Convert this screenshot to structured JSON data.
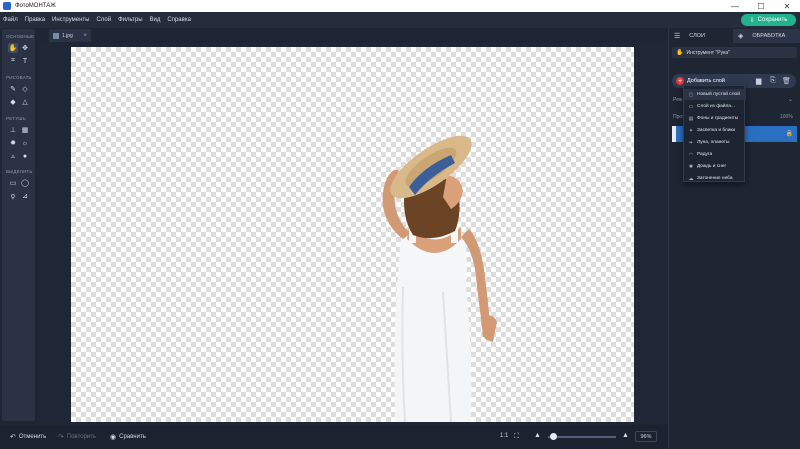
{
  "app": {
    "title": "ФотоМОНТАЖ"
  },
  "window_controls": {
    "minimize": "—",
    "maximize": "☐",
    "close": "✕"
  },
  "menu": [
    "Файл",
    "Правка",
    "Инструменты",
    "Слой",
    "Фильтры",
    "Вид",
    "Справка"
  ],
  "save_button": "Сохранить",
  "toolbar": {
    "sections": [
      "ОСНОВНЫЕ",
      "РИСОВАТЬ",
      "РЕТУШЬ",
      "ВЫДЕЛИТЬ"
    ]
  },
  "tab": {
    "label": "1.jpg",
    "close": "×"
  },
  "bottom": {
    "undo": "Отменить",
    "redo": "Повторить",
    "compare": "Сравнить",
    "actual_size": "1:1",
    "zoom": "96%"
  },
  "right_panel": {
    "tab_layers": "СЛОИ",
    "tab_processing": "ОБРАБОТКА",
    "tool_info": "Инструмент \"Рука\"",
    "add_layer": "Добавить слой",
    "mode_label": "Реж",
    "opacity_label": "Проз",
    "opacity_value": "100%"
  },
  "dropdown": [
    {
      "icon": "new-layer-icon",
      "glyph": "▢",
      "label": "Новый пустой слой"
    },
    {
      "icon": "file-icon",
      "glyph": "▭",
      "label": "Слой из файла..."
    },
    {
      "icon": "gradient-icon",
      "glyph": "▤",
      "label": "Фоны и градиенты"
    },
    {
      "icon": "sparkle-icon",
      "glyph": "✦",
      "label": "Засветка и блики"
    },
    {
      "icon": "leaf-icon",
      "glyph": "❧",
      "label": "Луна, планеты"
    },
    {
      "icon": "rainbow-icon",
      "glyph": "◠",
      "label": "Радуга"
    },
    {
      "icon": "snow-icon",
      "glyph": "✱",
      "label": "Дождь и снег"
    },
    {
      "icon": "cloud-icon",
      "glyph": "☁",
      "label": "Затонение неба"
    }
  ],
  "colors": {
    "accent": "#23b28c",
    "selection": "#2b6fc2",
    "background": "#1e2533"
  }
}
